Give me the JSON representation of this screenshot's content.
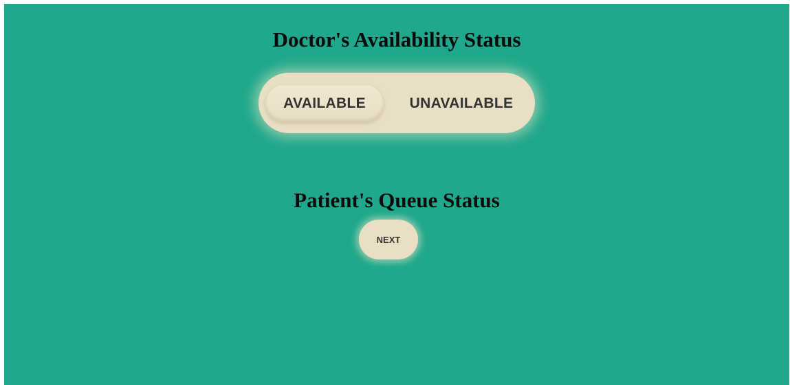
{
  "doctor_section": {
    "title": "Doctor's Availability Status",
    "toggle": {
      "options": [
        {
          "label": "AVAILABLE",
          "selected": true
        },
        {
          "label": "UNAVAILABLE",
          "selected": false
        }
      ]
    }
  },
  "patient_section": {
    "title": "Patient's Queue Status",
    "next_label": "NEXT"
  },
  "colors": {
    "background": "#1fa88b",
    "button": "#e9dfc5",
    "heading_text": "#0c0c0c",
    "button_text": "#333333"
  }
}
